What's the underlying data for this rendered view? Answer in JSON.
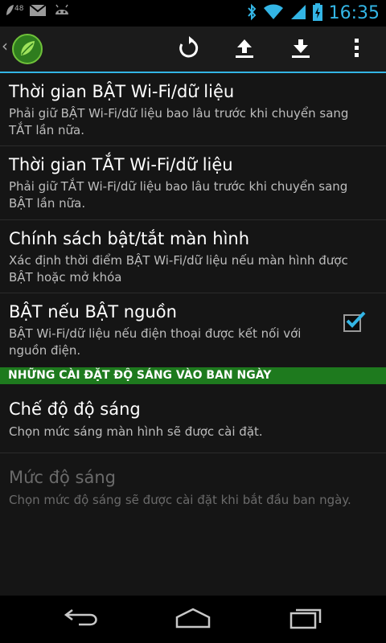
{
  "status_bar": {
    "notification_count": "48",
    "time": "16:35",
    "icons": [
      "leaf-notification-icon",
      "gmail-icon",
      "android-icon",
      "bluetooth-icon",
      "wifi-icon",
      "signal-icon",
      "battery-charging-icon"
    ]
  },
  "action_bar": {
    "icons": [
      "back-chevron-icon",
      "app-logo-icon",
      "refresh-icon",
      "upload-icon",
      "download-icon",
      "overflow-menu-icon"
    ]
  },
  "settings": {
    "items": [
      {
        "title": "Thời gian BẬT Wi-Fi/dữ liệu",
        "subtitle": "Phải giữ BẬT Wi-Fi/dữ liệu bao lâu trước khi chuyển sang TẮT lần nữa."
      },
      {
        "title": "Thời gian TẮT Wi-Fi/dữ liệu",
        "subtitle": "Phải giữ TẮT Wi-Fi/dữ liệu bao lâu trước khi chuyển sang BẬT lần nữa."
      },
      {
        "title": "Chính sách bật/tắt màn hình",
        "subtitle": "Xác định thời điểm BẬT Wi-Fi/dữ liệu nếu màn hình được BẬT hoặc mở khóa"
      },
      {
        "title": "BẬT nếu BẬT nguồn",
        "subtitle": "BẬT Wi-Fi/dữ liệu nếu điện thoại được kết nối với nguồn điện.",
        "checked": true
      }
    ],
    "section_header": "NHỮNG CÀI ĐẶT ĐỘ SÁNG VÀO BAN NGÀY",
    "brightness_items": [
      {
        "title": "Chế độ độ sáng",
        "subtitle": "Chọn mức sáng màn hình sẽ được cài đặt."
      },
      {
        "title": "Mức độ sáng",
        "subtitle": "Chọn mức độ sáng sẽ được cài đặt khi bắt đầu ban ngày.",
        "enabled": false
      }
    ]
  },
  "nav_bar": {
    "icons": [
      "back-icon",
      "home-icon",
      "recent-apps-icon"
    ]
  },
  "colors": {
    "accent": "#33b5e5",
    "section_green": "#1e7a1e",
    "background": "#151515"
  }
}
